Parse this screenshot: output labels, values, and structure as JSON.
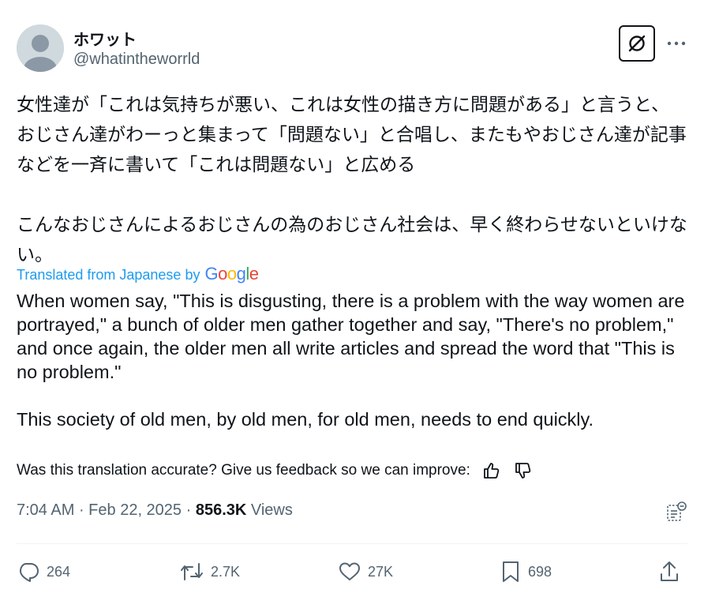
{
  "author": {
    "display_name": "ホワット",
    "handle": "@whatintheworrld"
  },
  "post": {
    "original_text": "女性達が「これは気持ちが悪い、これは女性の描き方に問題がある」と言うと、おじさん達がわーっと集まって「問題ない」と合唱し、またもやおじさん達が記事などを一斉に書いて「これは問題ない」と広める\n\nこんなおじさんによるおじさんの為のおじさん社会は、早く終わらせないといけない。",
    "translated_from_label": "Translated from Japanese by",
    "translator_brand": "Google",
    "translated_text": "When women say, \"This is disgusting, there is a problem with the way women are portrayed,\" a bunch of older men gather together and say, \"There's no problem,\" and once again, the older men all write articles and spread the word that \"This is no problem.\"\n\nThis society of old men, by old men, for old men, needs to end quickly.",
    "feedback_prompt": "Was this translation accurate? Give us feedback so we can improve:",
    "time": "7:04 AM",
    "separator": " · ",
    "date": "Feb 22, 2025",
    "views_count": "856.3K",
    "views_label": " Views"
  },
  "actions": {
    "replies": "264",
    "reposts": "2.7K",
    "likes": "27K",
    "bookmarks": "698"
  },
  "icons": {
    "grok": "grok-icon",
    "more": "more-icon",
    "thumbs_up": "thumbs-up-icon",
    "thumbs_down": "thumbs-down-icon",
    "analytics": "analytics-icon",
    "reply": "reply-icon",
    "repost": "repost-icon",
    "like": "heart-icon",
    "bookmark": "bookmark-icon",
    "share": "share-icon"
  },
  "colors": {
    "text": "#0f1419",
    "secondary": "#536471",
    "link": "#1d9bf0",
    "google_blue": "#4285F4",
    "google_red": "#EA4335",
    "google_yellow": "#FBBC05",
    "google_green": "#34A853"
  }
}
